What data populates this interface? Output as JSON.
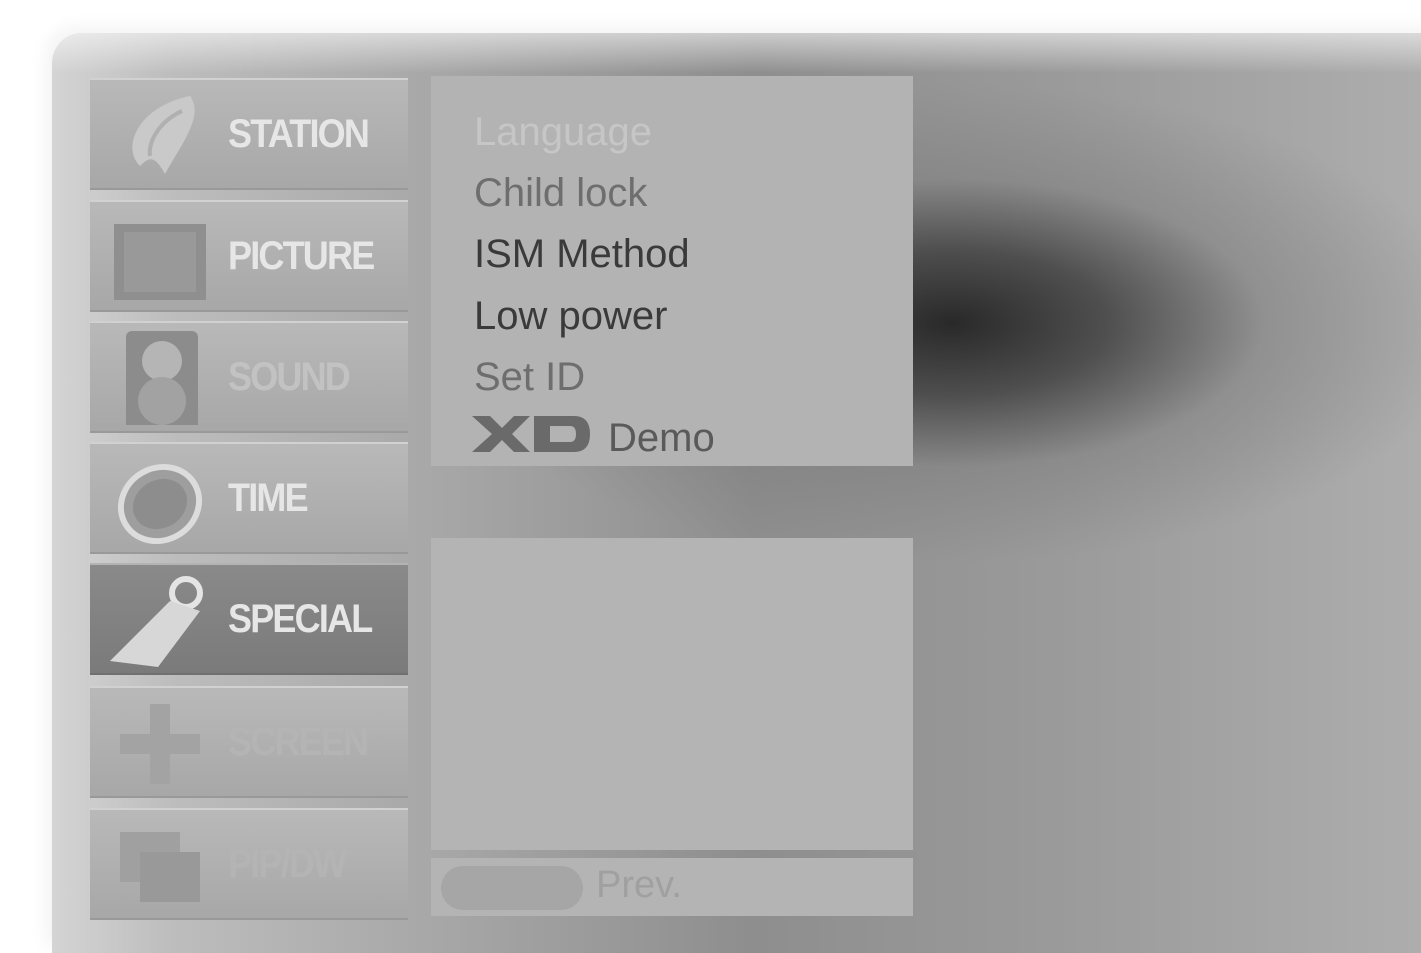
{
  "menu": {
    "tabs": [
      {
        "label": "STATION",
        "icon": "antenna-icon",
        "state": "normal"
      },
      {
        "label": "PICTURE",
        "icon": "picture-icon",
        "state": "normal"
      },
      {
        "label": "SOUND",
        "icon": "speaker-icon",
        "state": "dim"
      },
      {
        "label": "TIME",
        "icon": "clock-icon",
        "state": "normal"
      },
      {
        "label": "SPECIAL",
        "icon": "tag-icon",
        "state": "selected"
      },
      {
        "label": "SCREEN",
        "icon": "move-arrows-icon",
        "state": "faint"
      },
      {
        "label": "PIP/DW",
        "icon": "pip-icon",
        "state": "faint"
      }
    ]
  },
  "options": {
    "items": [
      {
        "label": "Language",
        "state": "faint"
      },
      {
        "label": "Child lock",
        "state": "dim"
      },
      {
        "label": "ISM Method",
        "state": "normal"
      },
      {
        "label": "Low power",
        "state": "normal"
      },
      {
        "label": "Set ID",
        "state": "dim"
      }
    ],
    "demo": {
      "logo": "XD",
      "label": "Demo"
    }
  },
  "footer": {
    "key_icon": "menu-key-icon",
    "prev_label": "Prev."
  },
  "colors": {
    "tab_bg": "#b0b0b0",
    "tab_selected_bg": "#7e7e7e",
    "panel_bg": "#b3b3b3",
    "option_text": "#3a3a3a"
  }
}
